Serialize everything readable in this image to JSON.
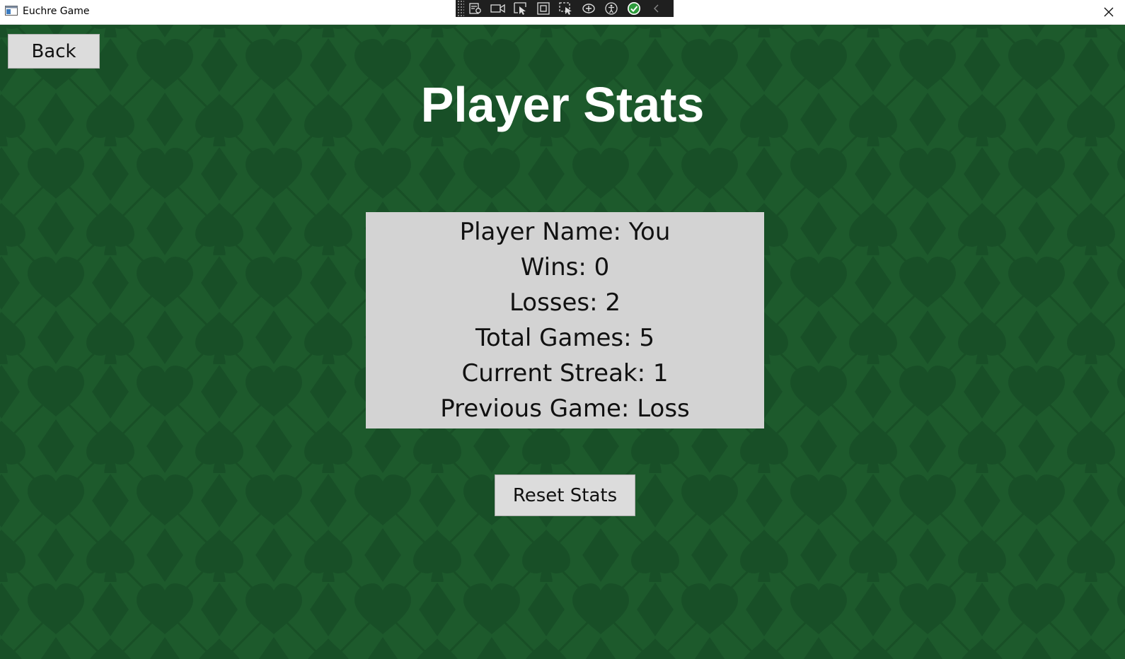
{
  "window": {
    "title": "Euchre Game",
    "icons": {
      "app": "app-window-icon",
      "close": "close-icon"
    }
  },
  "devtools": {
    "tools": [
      "live-visual-tree-icon",
      "record-icon",
      "select-element-icon",
      "display-layout-adorners-icon",
      "track-focus-icon",
      "binding-failures-icon",
      "accessibility-icon",
      "status-ok-icon",
      "collapse-chevron-icon"
    ]
  },
  "colors": {
    "felt": "#1d5a2c",
    "suit_shape": "#185227",
    "panel": "#d3d3d3",
    "button": "#dcdcdc",
    "title_text": "#ffffff"
  },
  "background_pattern": [
    "clubs",
    "diamonds",
    "hearts",
    "spades"
  ],
  "nav": {
    "back_label": "Back"
  },
  "page": {
    "title": "Player Stats"
  },
  "stats": {
    "player_name": "Player Name: You",
    "wins": "Wins: 0",
    "losses": "Losses: 2",
    "total_games": "Total Games: 5",
    "current_streak": "Current Streak: 1",
    "previous_game": "Previous Game: Loss"
  },
  "actions": {
    "reset_label": "Reset Stats"
  }
}
